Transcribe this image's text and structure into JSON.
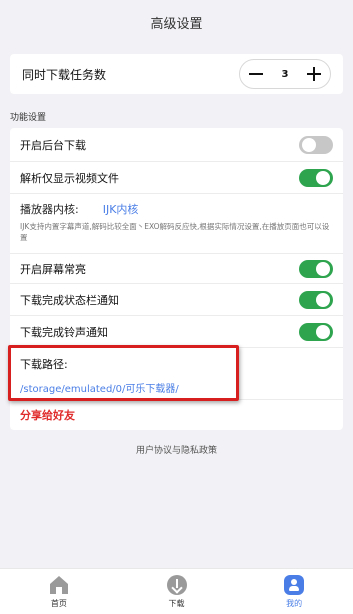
{
  "header": {
    "title": "高级设置"
  },
  "concurrent": {
    "label": "同时下载任务数",
    "value": "3"
  },
  "section": {
    "title": "功能设置"
  },
  "settings": {
    "background_download": {
      "label": "开启后台下载",
      "state": "off"
    },
    "video_only": {
      "label": "解析仅显示视频文件",
      "state": "on"
    },
    "player_core": {
      "label": "播放器内核:",
      "value": "IJK内核",
      "description": "IJK支持内置字幕声道,解码比较全面丶EXO解码反应快,根据实际情况设置,在播放页面也可以设置"
    },
    "screen_on": {
      "label": "开启屏幕常亮",
      "state": "on"
    },
    "status_notify": {
      "label": "下载完成状态栏通知",
      "state": "on"
    },
    "ring_notify": {
      "label": "下载完成铃声通知",
      "state": "on"
    },
    "download_path": {
      "label": "下载路径:",
      "value": "/storage/emulated/0/可乐下载器/"
    },
    "share": {
      "label": "分享给好友"
    }
  },
  "footer": {
    "policy": "用户协议与隐私政策"
  },
  "nav": {
    "home": "首页",
    "download": "下载",
    "me": "我的"
  },
  "colors": {
    "accent": "#4a7ee6",
    "toggle_on": "#2ea44f",
    "highlight": "#d81f1f",
    "share": "#e02b2b"
  }
}
